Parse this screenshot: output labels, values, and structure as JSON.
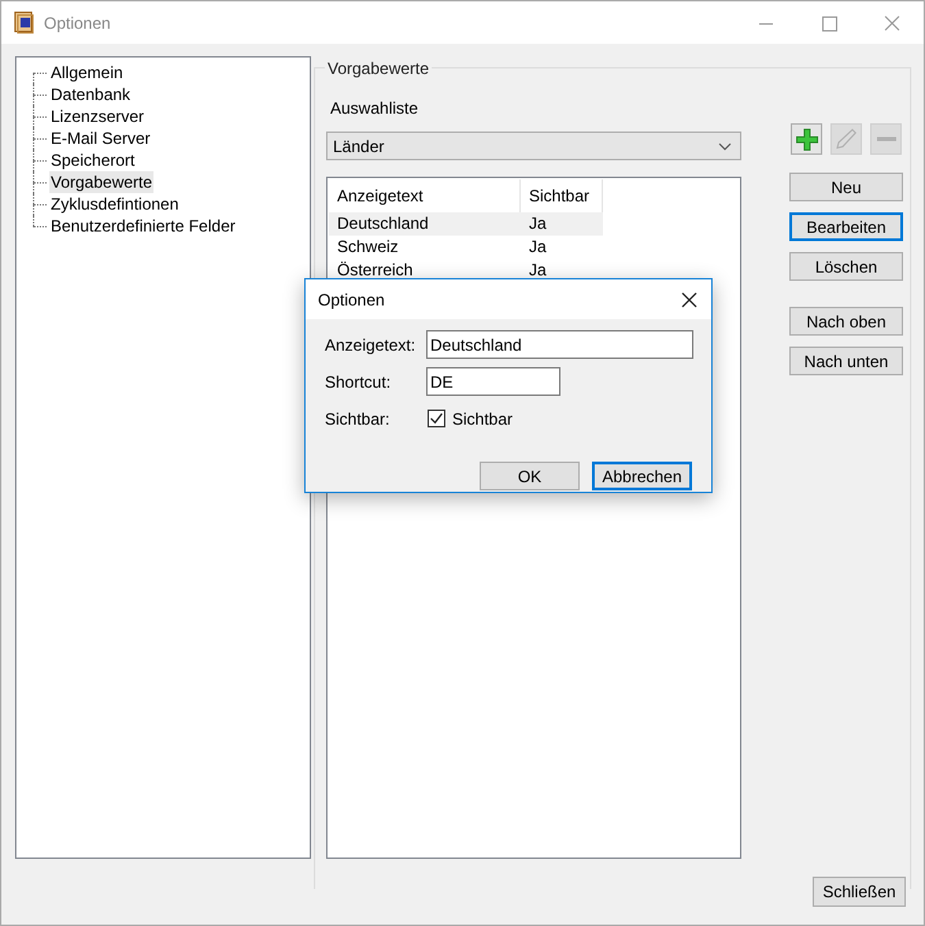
{
  "window": {
    "title": "Optionen"
  },
  "tree": {
    "items": [
      {
        "label": "Allgemein",
        "selected": false
      },
      {
        "label": "Datenbank",
        "selected": false
      },
      {
        "label": "Lizenzserver",
        "selected": false
      },
      {
        "label": "E-Mail Server",
        "selected": false
      },
      {
        "label": "Speicherort",
        "selected": false
      },
      {
        "label": "Vorgabewerte",
        "selected": true
      },
      {
        "label": "Zyklusdefintionen",
        "selected": false
      },
      {
        "label": "Benutzerdefinierte Felder",
        "selected": false
      }
    ]
  },
  "group": {
    "title": "Vorgabewerte",
    "list_label": "Auswahliste",
    "dropdown": {
      "value": "Länder"
    },
    "toolbar": [
      {
        "kind": "plus",
        "disabled": false
      },
      {
        "kind": "pencil",
        "disabled": true
      },
      {
        "kind": "minus",
        "disabled": true
      }
    ],
    "table": {
      "columns": [
        "Anzeigetext",
        "Sichtbar"
      ],
      "rows": [
        {
          "cells": [
            "Deutschland",
            "Ja"
          ],
          "selected": true
        },
        {
          "cells": [
            "Schweiz",
            "Ja"
          ],
          "selected": false
        },
        {
          "cells": [
            "Österreich",
            "Ja"
          ],
          "selected": false
        }
      ]
    },
    "buttons": [
      {
        "label": "Neu",
        "focused": false
      },
      {
        "label": "Bearbeiten",
        "focused": true
      },
      {
        "label": "Löschen",
        "focused": false
      }
    ],
    "move_buttons": [
      {
        "label": "Nach oben",
        "focused": false
      },
      {
        "label": "Nach unten",
        "focused": false
      }
    ]
  },
  "close_button": {
    "label": "Schließen"
  },
  "dialog": {
    "title": "Optionen",
    "fields": [
      {
        "kind": "text",
        "label": "Anzeigetext:",
        "value": "Deutschland",
        "wide": true
      },
      {
        "kind": "text",
        "label": "Shortcut:",
        "value": "DE",
        "wide": false
      },
      {
        "kind": "checkbox",
        "label": "Sichtbar:",
        "text": "Sichtbar",
        "checked": true
      }
    ],
    "buttons": [
      {
        "label": "OK",
        "focused": false
      },
      {
        "label": "Abbrechen",
        "focused": true
      }
    ]
  }
}
